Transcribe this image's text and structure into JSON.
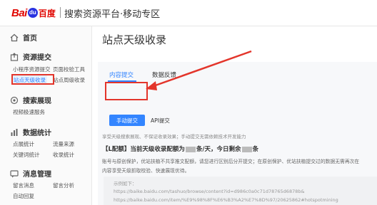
{
  "header": {
    "logo_bai": "Bai",
    "logo_paw": "du",
    "logo_du": "百度",
    "title": "搜索资源平台·移动专区"
  },
  "sidebar": {
    "home": "首页",
    "resource_submit": {
      "title": "资源提交",
      "items": [
        "小程序资源提交",
        "页面校验工具",
        "站点天级收录",
        "站点周级收录"
      ]
    },
    "search_display": {
      "title": "搜索展现",
      "items": [
        "视频极速服务"
      ]
    },
    "data_stats": {
      "title": "数据统计",
      "items": [
        "点展统计",
        "流量来源",
        "关键词统计",
        "收录统计"
      ]
    },
    "message": {
      "title": "消息管理",
      "items": [
        "留言消息",
        "留言分析",
        "自动回复"
      ]
    }
  },
  "main": {
    "page_title": "站点天级收录",
    "tabs": [
      "内容提交",
      "数据反馈"
    ],
    "submit_button": "手动提交",
    "api_label": "API提交",
    "desc": "享受天级搜索展现、不保证收录效果；手动提交无需依赖技术开发能力",
    "quota_line": {
      "prefix": "【L配额】当前天级收录配额为",
      "middle": "条/天，今日剩余",
      "suffix": "条"
    },
    "para1": "账号与原创保护，优站扶植不共享推文配额，请您进行区别后分开提交；在原创保护、优站扶植提交过的数据无需再次在",
    "para2": "内容享受天级抓取校验、快速展现优待。",
    "example": {
      "label": "示例如下：",
      "line1": "https://baike.baidu.com/tashuo/browse/content?id=d986c0a0c71d78765d6878b&",
      "line2": "https://baike.baidu.com/item/%E9%98%8F%E6%B3%A2%E7%8D%97/20625862#hotspotmining"
    }
  },
  "colors": {
    "accent": "#3385ff",
    "highlight": "#e3352b",
    "brand_red": "#e10601",
    "brand_blue": "#2932e1"
  }
}
